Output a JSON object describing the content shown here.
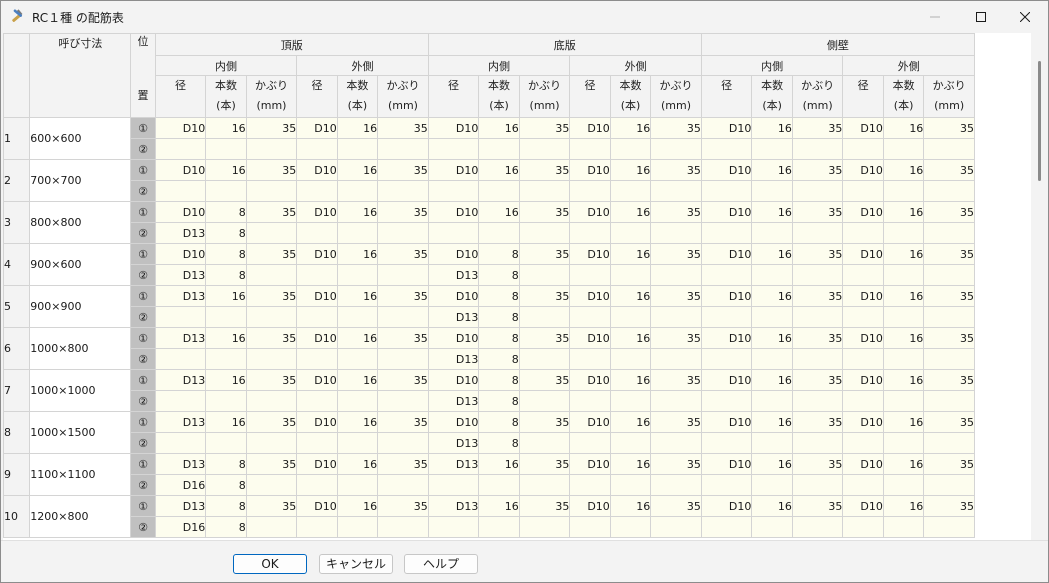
{
  "window": {
    "title": "RC１種 の配筋表",
    "icon": "tools-icon"
  },
  "columns": {
    "size": "呼び寸法",
    "pos_top": "位",
    "pos_bottom": "置",
    "groups": [
      "頂版",
      "底版",
      "側壁"
    ],
    "inner": "内側",
    "outer": "外側",
    "dia": "径",
    "count_line1": "本数",
    "count_line2": "(本)",
    "cover_line1": "かぶり",
    "cover_line2": "(mm)"
  },
  "positions": [
    "①",
    "②"
  ],
  "rows": [
    {
      "num": "1",
      "size": "600×600",
      "p1": [
        "D10",
        "16",
        "35",
        "D10",
        "16",
        "35",
        "D10",
        "16",
        "35",
        "D10",
        "16",
        "35",
        "D10",
        "16",
        "35",
        "D10",
        "16",
        "35"
      ],
      "p2": [
        "",
        "",
        "",
        "",
        "",
        "",
        "",
        "",
        "",
        "",
        "",
        "",
        "",
        "",
        "",
        "",
        "",
        ""
      ]
    },
    {
      "num": "2",
      "size": "700×700",
      "p1": [
        "D10",
        "16",
        "35",
        "D10",
        "16",
        "35",
        "D10",
        "16",
        "35",
        "D10",
        "16",
        "35",
        "D10",
        "16",
        "35",
        "D10",
        "16",
        "35"
      ],
      "p2": [
        "",
        "",
        "",
        "",
        "",
        "",
        "",
        "",
        "",
        "",
        "",
        "",
        "",
        "",
        "",
        "",
        "",
        ""
      ]
    },
    {
      "num": "3",
      "size": "800×800",
      "p1": [
        "D10",
        "8",
        "35",
        "D10",
        "16",
        "35",
        "D10",
        "16",
        "35",
        "D10",
        "16",
        "35",
        "D10",
        "16",
        "35",
        "D10",
        "16",
        "35"
      ],
      "p2": [
        "D13",
        "8",
        "",
        "",
        "",
        "",
        "",
        "",
        "",
        "",
        "",
        "",
        "",
        "",
        "",
        "",
        "",
        ""
      ]
    },
    {
      "num": "4",
      "size": "900×600",
      "p1": [
        "D10",
        "8",
        "35",
        "D10",
        "16",
        "35",
        "D10",
        "8",
        "35",
        "D10",
        "16",
        "35",
        "D10",
        "16",
        "35",
        "D10",
        "16",
        "35"
      ],
      "p2": [
        "D13",
        "8",
        "",
        "",
        "",
        "",
        "D13",
        "8",
        "",
        "",
        "",
        "",
        "",
        "",
        "",
        "",
        "",
        ""
      ]
    },
    {
      "num": "5",
      "size": "900×900",
      "p1": [
        "D13",
        "16",
        "35",
        "D10",
        "16",
        "35",
        "D10",
        "8",
        "35",
        "D10",
        "16",
        "35",
        "D10",
        "16",
        "35",
        "D10",
        "16",
        "35"
      ],
      "p2": [
        "",
        "",
        "",
        "",
        "",
        "",
        "D13",
        "8",
        "",
        "",
        "",
        "",
        "",
        "",
        "",
        "",
        "",
        ""
      ]
    },
    {
      "num": "6",
      "size": "1000×800",
      "p1": [
        "D13",
        "16",
        "35",
        "D10",
        "16",
        "35",
        "D10",
        "8",
        "35",
        "D10",
        "16",
        "35",
        "D10",
        "16",
        "35",
        "D10",
        "16",
        "35"
      ],
      "p2": [
        "",
        "",
        "",
        "",
        "",
        "",
        "D13",
        "8",
        "",
        "",
        "",
        "",
        "",
        "",
        "",
        "",
        "",
        ""
      ]
    },
    {
      "num": "7",
      "size": "1000×1000",
      "p1": [
        "D13",
        "16",
        "35",
        "D10",
        "16",
        "35",
        "D10",
        "8",
        "35",
        "D10",
        "16",
        "35",
        "D10",
        "16",
        "35",
        "D10",
        "16",
        "35"
      ],
      "p2": [
        "",
        "",
        "",
        "",
        "",
        "",
        "D13",
        "8",
        "",
        "",
        "",
        "",
        "",
        "",
        "",
        "",
        "",
        ""
      ]
    },
    {
      "num": "8",
      "size": "1000×1500",
      "p1": [
        "D13",
        "16",
        "35",
        "D10",
        "16",
        "35",
        "D10",
        "8",
        "35",
        "D10",
        "16",
        "35",
        "D10",
        "16",
        "35",
        "D10",
        "16",
        "35"
      ],
      "p2": [
        "",
        "",
        "",
        "",
        "",
        "",
        "D13",
        "8",
        "",
        "",
        "",
        "",
        "",
        "",
        "",
        "",
        "",
        ""
      ]
    },
    {
      "num": "9",
      "size": "1100×1100",
      "p1": [
        "D13",
        "8",
        "35",
        "D10",
        "16",
        "35",
        "D13",
        "16",
        "35",
        "D10",
        "16",
        "35",
        "D10",
        "16",
        "35",
        "D10",
        "16",
        "35"
      ],
      "p2": [
        "D16",
        "8",
        "",
        "",
        "",
        "",
        "",
        "",
        "",
        "",
        "",
        "",
        "",
        "",
        "",
        "",
        "",
        ""
      ]
    },
    {
      "num": "10",
      "size": "1200×800",
      "p1": [
        "D13",
        "8",
        "35",
        "D10",
        "16",
        "35",
        "D13",
        "16",
        "35",
        "D10",
        "16",
        "35",
        "D10",
        "16",
        "35",
        "D10",
        "16",
        "35"
      ],
      "p2": [
        "D16",
        "8",
        "",
        "",
        "",
        "",
        "",
        "",
        "",
        "",
        "",
        "",
        "",
        "",
        "",
        "",
        "",
        ""
      ]
    }
  ],
  "footer": {
    "ok": "OK",
    "cancel": "キャンセル",
    "help": "ヘルプ"
  },
  "colors": {
    "cell_bg": "#fdfdee",
    "position_bg": "#c0c0c0",
    "header_bg": "#f3f3f3",
    "accent": "#0067c0"
  }
}
